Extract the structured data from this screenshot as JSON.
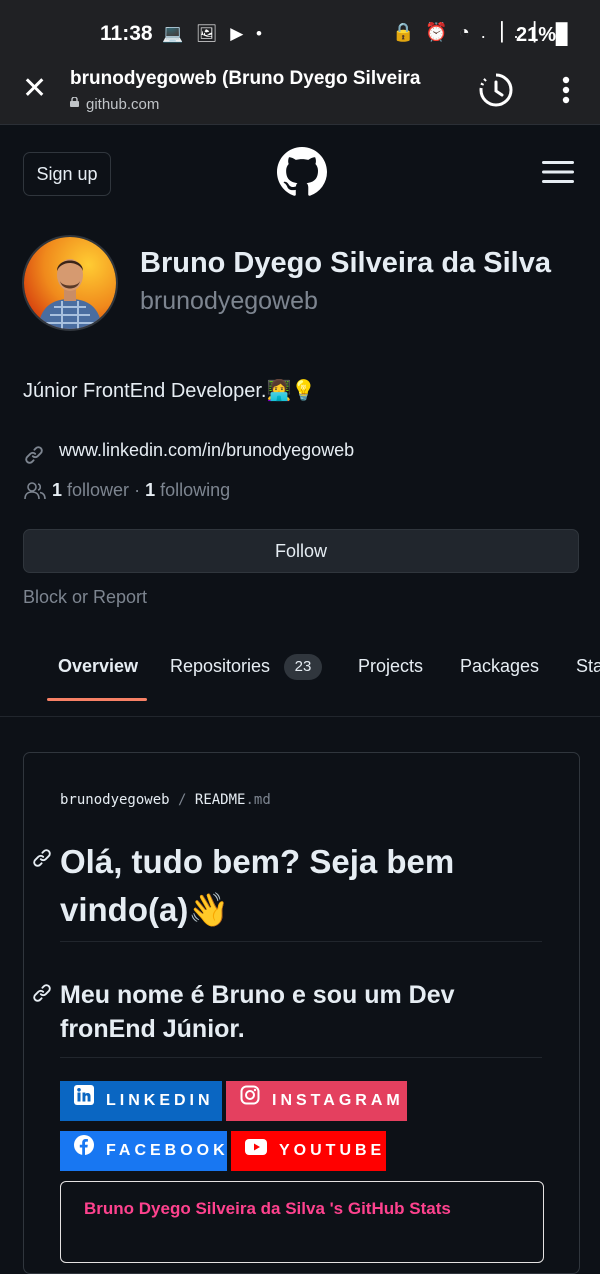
{
  "status_bar": {
    "time": "11:38",
    "left_icons": "💻 🖼 ▶ •",
    "right_icons": "🔒 ⏰ ◔ .▕ .▕",
    "battery": "21%▊"
  },
  "browser": {
    "page_title": "brunodyegoweb (Bruno Dyego Silveira",
    "url": "github.com"
  },
  "header": {
    "signup_label": "Sign up"
  },
  "profile": {
    "full_name": "Bruno Dyego Silveira da Silva",
    "username": "brunodyegoweb",
    "bio": "Júnior FrontEnd Developer.👩‍💻💡",
    "website": "www.linkedin.com/in/brunodyegoweb",
    "followers_count": "1",
    "followers_label": "follower",
    "separator": "·",
    "following_count": "1",
    "following_label": "following",
    "follow_button": "Follow",
    "block_report": "Block or Report"
  },
  "tabs": [
    {
      "label": "Overview"
    },
    {
      "label": "Repositories",
      "count": "23"
    },
    {
      "label": "Projects"
    },
    {
      "label": "Packages"
    },
    {
      "label": "Sta"
    }
  ],
  "readme": {
    "owner": "brunodyegoweb",
    "sep": "/",
    "file_name": "README",
    "file_ext": ".md",
    "heading1": "Olá, tudo bem? Seja bem vindo(a)👋",
    "heading2": "Meu nome é Bruno e sou um Dev fronEnd Júnior.",
    "badges": [
      {
        "label": "LINKEDIN",
        "color": "#0a66c2"
      },
      {
        "label": "INSTAGRAM",
        "color": "#e4405f"
      },
      {
        "label": "FACEBOOK",
        "color": "#1877f2"
      },
      {
        "label": "YOUTUBE",
        "color": "#ff0000"
      }
    ],
    "stats_title": "Bruno Dyego Silveira da Silva 's GitHub Stats"
  },
  "colors": {
    "background": "#0d1117",
    "tab_underline": "#f78166",
    "stats_title": "#fe428e"
  }
}
